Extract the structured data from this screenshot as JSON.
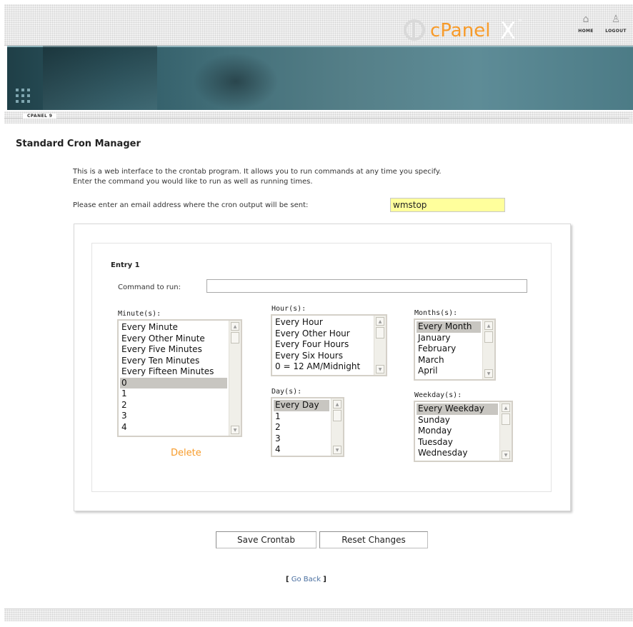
{
  "header": {
    "nav": [
      {
        "label": "HOME",
        "icon": "home-icon"
      },
      {
        "label": "LOGOUT",
        "icon": "logout-icon"
      }
    ]
  },
  "banner": {
    "logo_text": "cPanel",
    "logo_x": "X",
    "logo_tm": "™"
  },
  "breadcrumb": "CPANEL 9",
  "page": {
    "title": "Standard Cron Manager",
    "intro_line1": "This is a web interface to the crontab program. It allows you to run commands at any time you specify.",
    "intro_line2": "Enter the command you would like to run as well as running times.",
    "email_prompt": "Please enter an email address where the cron output will be sent:",
    "email_value": "wmstop"
  },
  "entry": {
    "title": "Entry 1",
    "command_label": "Command to run:",
    "command_value": "",
    "minute": {
      "label": "Minute(s):",
      "options": [
        "Every Minute",
        "Every Other Minute",
        "Every Five Minutes",
        "Every Ten Minutes",
        "Every Fifteen Minutes",
        "0",
        "1",
        "2",
        "3",
        "4"
      ],
      "selected": "0"
    },
    "hour": {
      "label": "Hour(s):",
      "options": [
        "Every Hour",
        "Every Other Hour",
        "Every Four Hours",
        "Every Six Hours",
        "0 = 12 AM/Midnight"
      ],
      "selected": ""
    },
    "month": {
      "label": "Months(s):",
      "options": [
        "Every Month",
        "January",
        "February",
        "March",
        "April"
      ],
      "selected": "Every Month"
    },
    "day": {
      "label": "Day(s):",
      "options": [
        "Every Day",
        "1",
        "2",
        "3",
        "4"
      ],
      "selected": "Every Day"
    },
    "weekday": {
      "label": "Weekday(s):",
      "options": [
        "Every Weekday",
        "Sunday",
        "Monday",
        "Tuesday",
        "Wednesday"
      ],
      "selected": "Every Weekday"
    },
    "delete_label": "Delete"
  },
  "buttons": {
    "save": "Save Crontab",
    "reset": "Reset Changes"
  },
  "goback": {
    "open": "[",
    "label": "Go Back",
    "close": "]"
  },
  "colors": {
    "accent_orange": "#f79b2a",
    "email_bg": "#ffff9c",
    "link_blue": "#4a6fa0"
  }
}
